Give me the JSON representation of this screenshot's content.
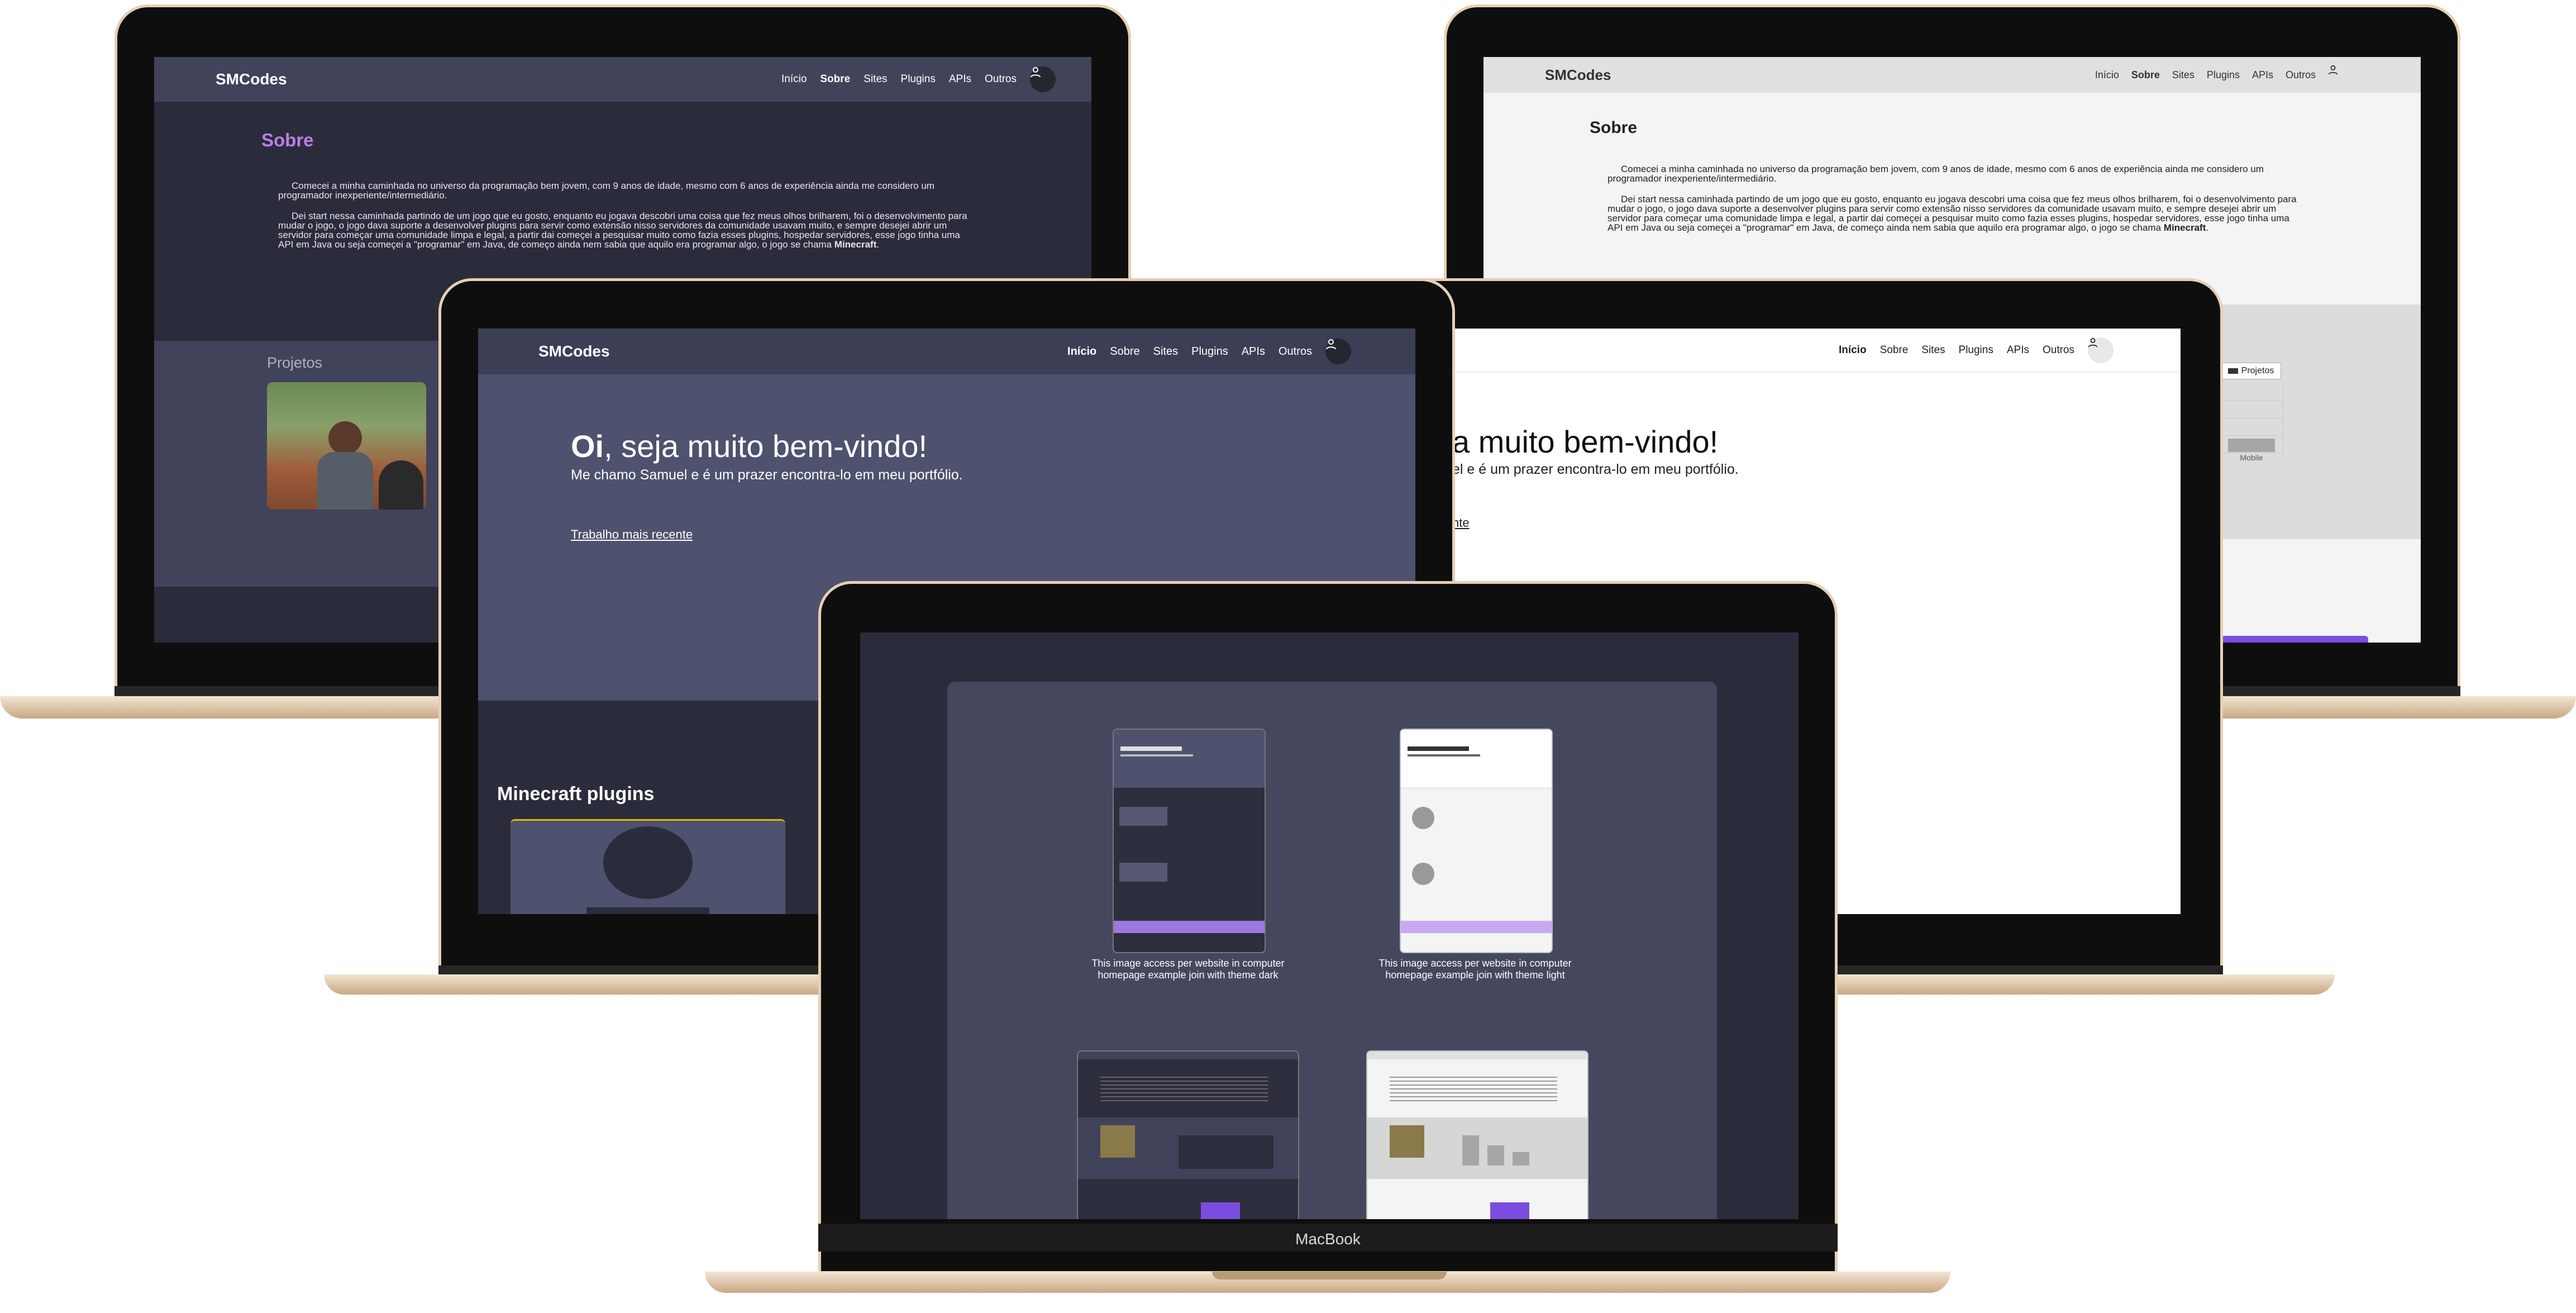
{
  "brand": "SMCodes",
  "nav": {
    "items": [
      "Início",
      "Sobre",
      "Sites",
      "Plugins",
      "APIs",
      "Outros"
    ],
    "active_home": "Início",
    "active_about": "Sobre"
  },
  "about": {
    "title": "Sobre",
    "paragraph1": "Comecei a minha caminhada no universo da programação bem jovem, com 9 anos de idade, mesmo com 6 anos de experiência ainda me considero um programador inexperiente/intermediário.",
    "paragraph2_start": "Dei start nessa caminhada partindo de um jogo que eu gosto, enquanto eu jogava descobri uma coisa que fez meus olhos brilharem, foi o desenvolvimento para mudar o jogo, o jogo dava suporte a desenvolver plugins para servir como extensão nisso servidores da comunidade usavam muito, e sempre desejei abrir um servidor para começar uma comunidade limpa e legal, a partir dai começei a pesquisar muito como fazia esses plugins, hospedar servidores, esse jogo tinha uma API em Java ou seja começei a \"programar\" em Java, de começo ainda nem sabia que aquilo era programar algo, o jogo se chama",
    "paragraph2_strong": "Minecraft",
    "projects_label": "Projetos"
  },
  "home": {
    "greet_strong": "Oi",
    "greet_rest": ", seja muito bem-vindo!",
    "greet_partial": "a muito bem-vindo!",
    "subtitle": "Me chamo Samuel e é um prazer encontra-lo em meu portfólio.",
    "subtitle_partial": "el e é um prazer encontra-lo em meu portfólio.",
    "latest_link": "Trabalho mais recente",
    "latest_link_partial": "nte",
    "plugins_heading": "Minecraft plugins"
  },
  "chart": {
    "legend": "Projetos",
    "category": "Mobile"
  },
  "showcase": {
    "caption_dark": "This image access per website in computer homepage example join with theme dark",
    "caption_light": "This image access per website in computer homepage example join with theme light"
  },
  "device_label": "MacBook",
  "colors": {
    "dark_nav": "#41435a",
    "dark_body": "#2b2c3b",
    "accent_purple": "#b87fe8",
    "light_nav": "#dfe0e0",
    "light_body": "#f4f4f4"
  }
}
